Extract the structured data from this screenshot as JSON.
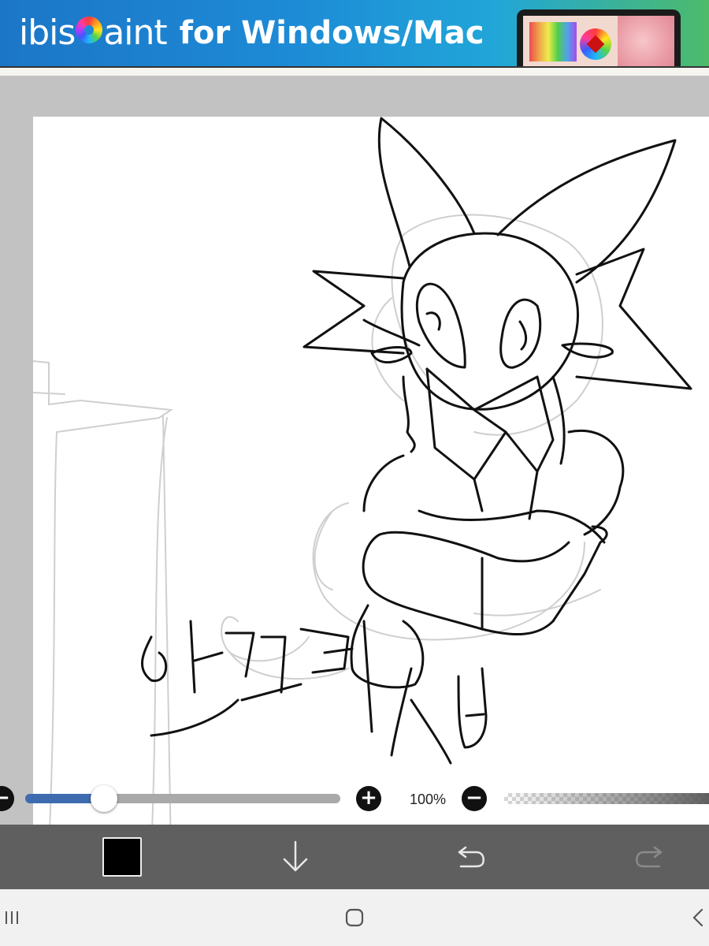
{
  "banner": {
    "brand": "ibisPaint",
    "brand_prefix": "ibis",
    "brand_suffix": "aint",
    "tagline": "for Windows/Mac",
    "colors": {
      "left": "#1c76c7",
      "right": "#4dbb6a",
      "underline": "#f5e000"
    }
  },
  "canvas": {
    "background": "#ffffff",
    "drawing": "character sketch with handwritten Korean text"
  },
  "brush": {
    "size_fraction": 0.25,
    "zoom_label": "100%",
    "accent": "#3f6bb0"
  },
  "toolbar": {
    "color_swatch": "#000000",
    "icons": [
      "color-swatch",
      "download-arrow",
      "undo-arrow",
      "redo-arrow"
    ]
  },
  "navbar": {
    "icons": [
      "recent-apps",
      "home",
      "back"
    ]
  }
}
